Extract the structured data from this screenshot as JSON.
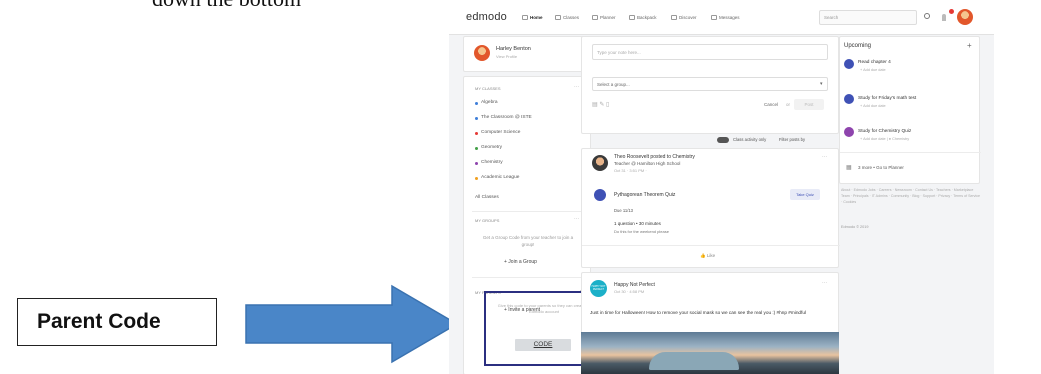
{
  "document": {
    "text_fragment": "down the bottom"
  },
  "callout": {
    "label": "Parent Code"
  },
  "app": {
    "logo": "edmodo",
    "nav": [
      "Home",
      "Classes",
      "Planner",
      "Backpack",
      "Discover",
      "Messages"
    ],
    "search_placeholder": "Search"
  },
  "profile": {
    "name": "Harley Benton",
    "link": "View Profile"
  },
  "my_classes": {
    "heading": "MY CLASSES",
    "items": [
      {
        "label": "Algebra",
        "color": "#3f7fd9"
      },
      {
        "label": "The Classroom @ ISTE",
        "color": "#3f7fd9"
      },
      {
        "label": "Computer Science",
        "color": "#e53935"
      },
      {
        "label": "Geometry",
        "color": "#43a047"
      },
      {
        "label": "Chemistry",
        "color": "#8e44ad"
      },
      {
        "label": "Academic League",
        "color": "#f0a020"
      }
    ],
    "all": "All Classes"
  },
  "my_groups": {
    "heading": "MY GROUPS",
    "hint": "Get a Group Code from your teacher to join a group!",
    "join": "+ Join a Group"
  },
  "my_parents": {
    "heading": "MY PARENTS",
    "count": "0",
    "invite": "+ Invite a parent",
    "share_text": "Give this code to your parents so they can create an Edmodo account",
    "code_button": "CODE"
  },
  "composer": {
    "placeholder": "Type your note here...",
    "group_select": "Select a group...",
    "cancel": "Cancel",
    "or": "or",
    "post": "Post",
    "class_activity": "Class activity only",
    "filter": "Filter posts by"
  },
  "post1": {
    "author": "Theo Roosevelt posted to Chemistry",
    "role": "Teacher @ Hamilton High School",
    "time": "Oct 31 · 3:51 PM ·",
    "quiz_title": "Pythagorean Theorem Quiz",
    "take_quiz": "Take Quiz",
    "due": "Due 11/13",
    "meta": "1 question • 30 minutes",
    "note": "Do this for the weekend please",
    "like": "Like"
  },
  "post2": {
    "author": "Happy Not Perfect",
    "avatar_text": "HAPPY NOT PERFECT",
    "time": "Oct 30 · 4:58 PM",
    "body": "Just in time for Halloween! How to remove your social mask so we can see the real you :) #hnp #mindful"
  },
  "upcoming": {
    "title": "Upcoming",
    "items": [
      {
        "title": "Read chapter 4",
        "sub": "+ Add due date"
      },
      {
        "title": "Study for Friday's math test",
        "sub": "+ Add due date"
      },
      {
        "title": "Study for Chemistry Quiz",
        "sub": "+ Add due date | ● Chemistry"
      }
    ],
    "more": "3 more • Go to Planner"
  },
  "footer": {
    "links": "About · Edmodo Jobs · Careers · Newsroom · Contact Us · Teachers · Marketplace Team · Principals · IT Admins · Community · Blog · Support · Privacy · Terms of Service · Cookies",
    "copyright": "Edmodo © 2019"
  },
  "colors": {
    "accent": "#3f51b5",
    "code_outline": "#2b2f80",
    "arrow": "#4a86c8"
  }
}
